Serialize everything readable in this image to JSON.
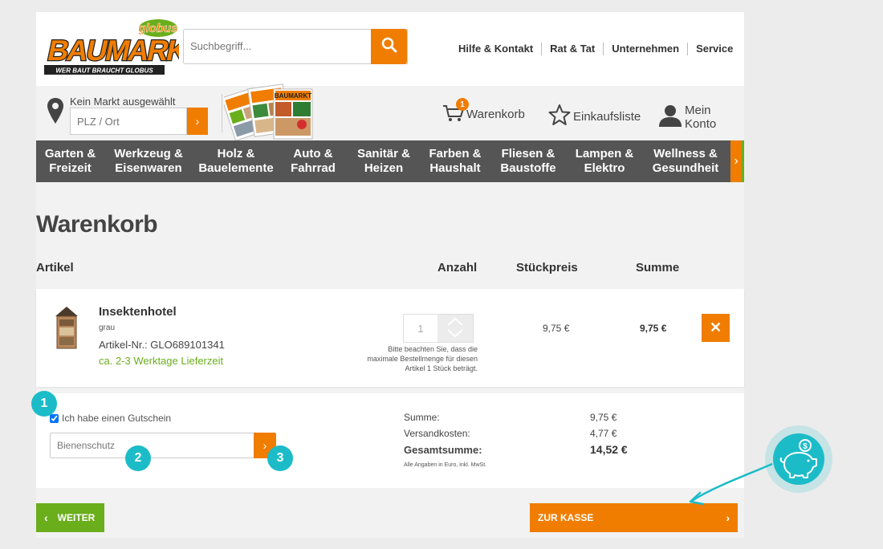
{
  "header": {
    "logo_text": "BAUMARKT",
    "logo_brand": "globus",
    "logo_slogan": "WER BAUT BRAUCHT GLOBUS",
    "search_placeholder": "Suchbegriff...",
    "top_links": [
      "Hilfe & Kontakt",
      "Rat & Tat",
      "Unternehmen",
      "Service"
    ]
  },
  "store": {
    "label": "Kein Markt ausgewählt",
    "plz_placeholder": "PLZ / Ort"
  },
  "actions": {
    "cart_label": "Warenkorb",
    "cart_count": "1",
    "list_label": "Einkaufsliste",
    "account_label": "Mein Konto"
  },
  "nav": [
    {
      "line1": "Garten &",
      "line2": "Freizeit"
    },
    {
      "line1": "Werkzeug &",
      "line2": "Eisenwaren"
    },
    {
      "line1": "Holz &",
      "line2": "Bauelemente"
    },
    {
      "line1": "Auto &",
      "line2": "Fahrrad"
    },
    {
      "line1": "Sanitär &",
      "line2": "Heizen"
    },
    {
      "line1": "Farben &",
      "line2": "Haushalt"
    },
    {
      "line1": "Fliesen &",
      "line2": "Baustoffe"
    },
    {
      "line1": "Lampen &",
      "line2": "Elektro"
    },
    {
      "line1": "Wellness &",
      "line2": "Gesundheit"
    }
  ],
  "cart": {
    "title": "Warenkorb",
    "columns": {
      "article": "Artikel",
      "quantity": "Anzahl",
      "unit_price": "Stückpreis",
      "sum": "Summe"
    },
    "item": {
      "name": "Insektenhotel",
      "variant": "grau",
      "article_no": "Artikel-Nr.: GLO689101341",
      "delivery": "ca. 2-3 Werktage Lieferzeit",
      "quantity": "1",
      "quantity_note": "Bitte beachten Sie, dass die maximale Bestellmenge für diesen Artikel 1 Stück beträgt.",
      "unit_price": "9,75 €",
      "total": "9,75 €"
    }
  },
  "voucher": {
    "checkbox_label": "Ich habe einen Gutschein",
    "checked": true,
    "code_value": "Bienenschutz"
  },
  "summary": {
    "subtotal_label": "Summe:",
    "subtotal": "9,75 €",
    "shipping_label": "Versandkosten:",
    "shipping": "4,77 €",
    "grand_total_label": "Gesamtsumme:",
    "grand_total": "14,52 €",
    "note": "Alle Angaben in Euro, inkl. MwSt."
  },
  "buttons": {
    "continue": "WEITER",
    "checkout": "ZUR KASSE"
  },
  "annotations": {
    "step1": "1",
    "step2": "2",
    "step3": "3"
  },
  "colors": {
    "accent_orange": "#f07d00",
    "green": "#6aae1c",
    "teal_annotation": "#1bbcc8",
    "nav_bg": "#555555"
  },
  "icons": [
    "search-icon",
    "location-pin-icon",
    "cart-icon",
    "star-icon",
    "user-icon",
    "chevron-right-icon",
    "close-icon",
    "piggy-bank-icon"
  ]
}
